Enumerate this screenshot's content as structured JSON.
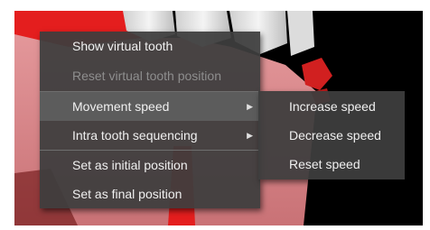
{
  "context_menu": {
    "items": [
      {
        "label": "Show virtual tooth",
        "disabled": false
      },
      {
        "label": "Reset virtual tooth position",
        "disabled": true
      },
      {
        "label": "Movement speed",
        "highlighted": true,
        "has_submenu": true
      },
      {
        "label": "Intra tooth sequencing",
        "has_submenu": true
      },
      {
        "label": "Set as initial position"
      },
      {
        "label": "Set as final position"
      }
    ],
    "submenu_arrow": "▶"
  },
  "submenu": {
    "items": [
      {
        "label": "Increase speed"
      },
      {
        "label": "Decrease speed"
      },
      {
        "label": "Reset speed"
      }
    ]
  },
  "colors": {
    "menu_background": "#3e3e3e",
    "highlight": "#5c5c5c",
    "disabled_text": "#8e8e8e",
    "gum": "#d9878a",
    "tooth": "#e9e9e9",
    "attachment_red": "#e41e1e"
  }
}
